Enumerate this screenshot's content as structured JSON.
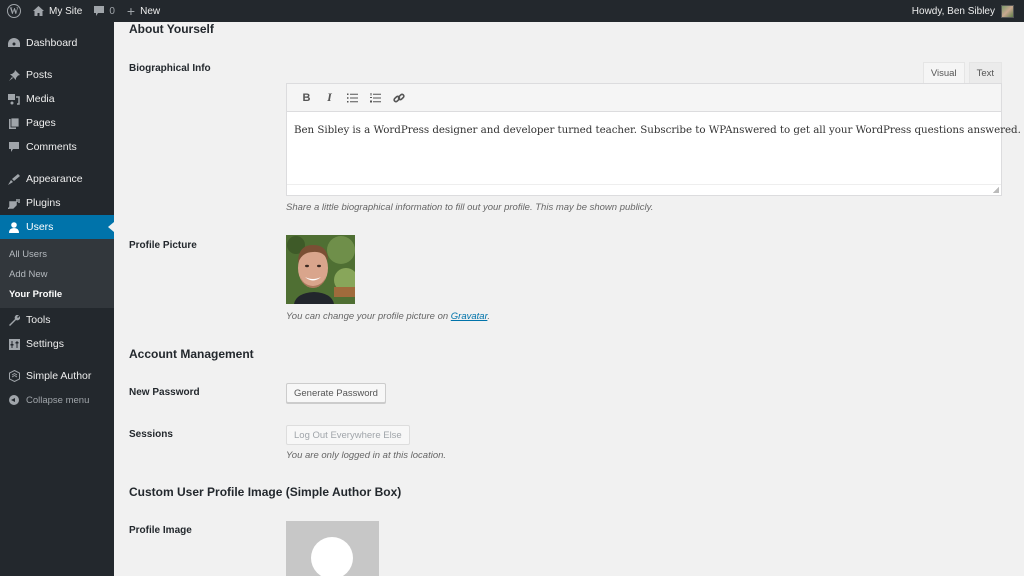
{
  "adminbar": {
    "site_name": "My Site",
    "comment_count": "0",
    "new_label": "New",
    "howdy": "Howdy, Ben Sibley"
  },
  "sidebar": {
    "items": [
      {
        "label": "Dashboard",
        "icon": "dashboard-icon"
      },
      {
        "label": "Posts",
        "icon": "pin-icon"
      },
      {
        "label": "Media",
        "icon": "media-icon"
      },
      {
        "label": "Pages",
        "icon": "pages-icon"
      },
      {
        "label": "Comments",
        "icon": "comment-icon"
      },
      {
        "label": "Appearance",
        "icon": "paintbrush-icon"
      },
      {
        "label": "Plugins",
        "icon": "plug-icon"
      },
      {
        "label": "Users",
        "icon": "user-icon"
      },
      {
        "label": "Tools",
        "icon": "wrench-icon"
      },
      {
        "label": "Settings",
        "icon": "settings-icon"
      },
      {
        "label": "Simple Author",
        "icon": "hexagon-icon"
      },
      {
        "label": "Collapse menu",
        "icon": "collapse-icon"
      }
    ],
    "users_submenu": [
      "All Users",
      "Add New",
      "Your Profile"
    ],
    "active_color": "#0073aa"
  },
  "about": {
    "heading": "About Yourself",
    "bio_label": "Biographical Info",
    "tabs": [
      "Visual",
      "Text"
    ],
    "bio_text": "Ben Sibley is a WordPress designer and developer turned teacher. Subscribe to WPAnswered to get all your WordPress questions answered.",
    "bio_desc": "Share a little biographical information to fill out your profile. This may be shown publicly.",
    "picture_label": "Profile Picture",
    "picture_desc_prefix": "You can change your profile picture on ",
    "picture_desc_link": "Gravatar",
    "picture_desc_suffix": "."
  },
  "account": {
    "heading": "Account Management",
    "password_label": "New Password",
    "generate_button": "Generate Password",
    "sessions_label": "Sessions",
    "logout_button": "Log Out Everywhere Else",
    "sessions_desc": "You are only logged in at this location."
  },
  "custom_image": {
    "heading": "Custom User Profile Image (Simple Author Box)",
    "label": "Profile Image"
  }
}
